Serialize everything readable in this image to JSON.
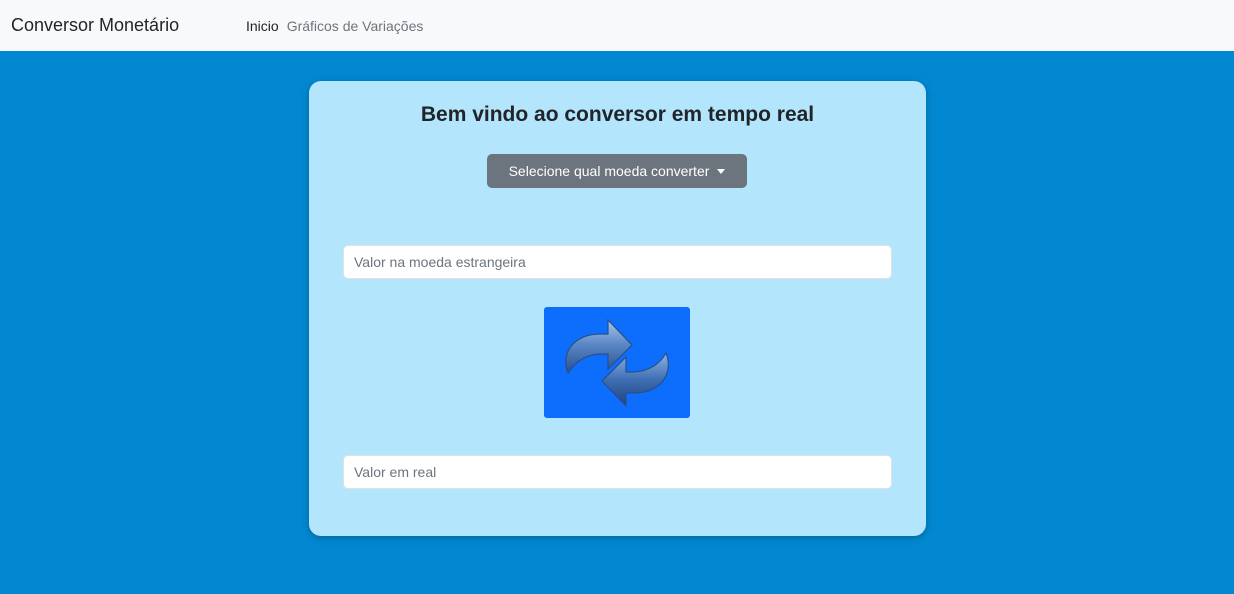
{
  "navbar": {
    "brand": "Conversor Monetário",
    "links": [
      {
        "label": "Inicio"
      },
      {
        "label": "Gráficos de Variações"
      }
    ]
  },
  "card": {
    "title": "Bem vindo ao conversor em tempo real",
    "dropdown_label": "Selecione qual moeda converter",
    "foreign_placeholder": "Valor na moeda estrangeira",
    "real_placeholder": "Valor em real",
    "swap_icon": "swap-arrows-icon"
  },
  "colors": {
    "page_background": "#0288d1",
    "navbar_background": "#f8f9fa",
    "card_background": "#b3e5fc",
    "dropdown_background": "#6c757d",
    "swap_background": "#0d6efd"
  }
}
